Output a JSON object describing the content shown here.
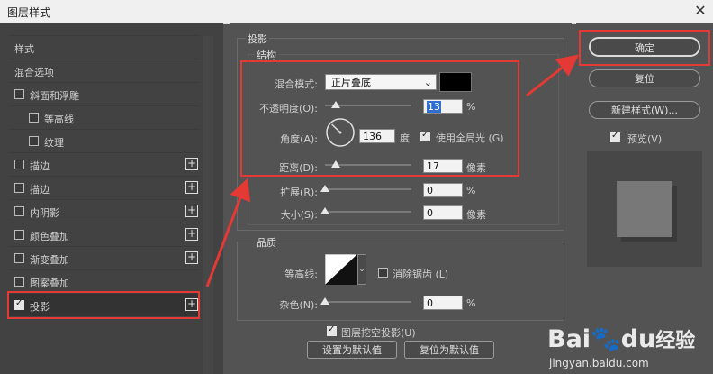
{
  "window": {
    "title": "图层样式",
    "close_icon": "✕"
  },
  "left_panel": {
    "items": [
      {
        "label": "样式",
        "checkbox": false,
        "checked": false,
        "plus": false,
        "indent": 0
      },
      {
        "label": "混合选项",
        "checkbox": false,
        "checked": false,
        "plus": false,
        "indent": 0
      },
      {
        "label": "斜面和浮雕",
        "checkbox": true,
        "checked": false,
        "plus": false,
        "indent": 0
      },
      {
        "label": "等高线",
        "checkbox": true,
        "checked": false,
        "plus": false,
        "indent": 1
      },
      {
        "label": "纹理",
        "checkbox": true,
        "checked": false,
        "plus": false,
        "indent": 1
      },
      {
        "label": "描边",
        "checkbox": true,
        "checked": false,
        "plus": true,
        "indent": 0
      },
      {
        "label": "描边",
        "checkbox": true,
        "checked": false,
        "plus": true,
        "indent": 0
      },
      {
        "label": "内阴影",
        "checkbox": true,
        "checked": false,
        "plus": true,
        "indent": 0
      },
      {
        "label": "颜色叠加",
        "checkbox": true,
        "checked": false,
        "plus": true,
        "indent": 0
      },
      {
        "label": "渐变叠加",
        "checkbox": true,
        "checked": false,
        "plus": true,
        "indent": 0
      },
      {
        "label": "图案叠加",
        "checkbox": true,
        "checked": false,
        "plus": false,
        "indent": 0
      },
      {
        "label": "投影",
        "checkbox": true,
        "checked": true,
        "plus": true,
        "indent": 0,
        "selected": true
      }
    ]
  },
  "shadow": {
    "section_title": "投影",
    "structure": {
      "title": "结构",
      "blend_mode_label": "混合模式:",
      "blend_mode_value": "正片叠底",
      "shadow_color": "#000000",
      "opacity_label": "不透明度(O):",
      "opacity_value": "13",
      "opacity_unit": "%",
      "opacity_fraction": 0.13,
      "angle_label": "角度(A):",
      "angle_value": "136",
      "angle_unit": "度",
      "global_light_label": "使用全局光 (G)",
      "global_light_checked": true,
      "distance_label": "距离(D):",
      "distance_value": "17",
      "distance_unit": "像素",
      "distance_fraction": 0.12,
      "spread_label": "扩展(R):",
      "spread_value": "0",
      "spread_unit": "%",
      "spread_fraction": 0.0,
      "size_label": "大小(S):",
      "size_value": "0",
      "size_unit": "像素",
      "size_fraction": 0.0
    },
    "quality": {
      "title": "品质",
      "contour_label": "等高线:",
      "antialias_label": "消除锯齿 (L)",
      "antialias_checked": false,
      "noise_label": "杂色(N):",
      "noise_value": "0",
      "noise_unit": "%",
      "noise_fraction": 0.0
    },
    "knockout_label": "图层挖空投影(U)",
    "knockout_checked": true,
    "make_default_label": "设置为默认值",
    "reset_default_label": "复位为默认值"
  },
  "right_panel": {
    "ok_label": "确定",
    "reset_label": "复位",
    "new_style_label": "新建样式(W)...",
    "preview_label": "预览(V)",
    "preview_checked": true
  },
  "watermark": {
    "brand_a": "Bai",
    "brand_b": "du",
    "brand_c": "经验",
    "url": "jingyan.baidu.com"
  },
  "annotation_colors": {
    "highlight": "#e53935"
  }
}
